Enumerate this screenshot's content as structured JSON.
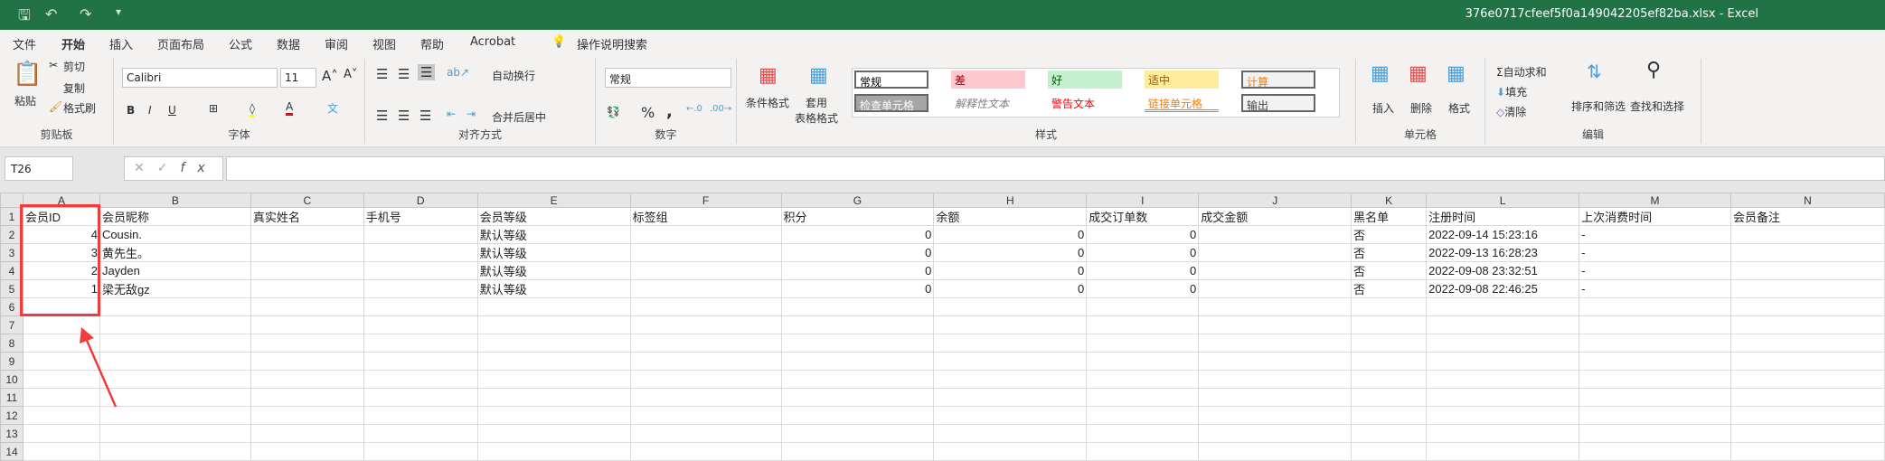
{
  "title_bar": {
    "filename": "376e0717cfeef5f0a149042205ef82ba.xlsx  -  Excel",
    "save_icon": "save-icon",
    "undo_icon": "undo-icon",
    "redo_icon": "redo-icon"
  },
  "tabs": [
    {
      "label": "文件"
    },
    {
      "label": "开始",
      "active": true
    },
    {
      "label": "插入"
    },
    {
      "label": "页面布局"
    },
    {
      "label": "公式"
    },
    {
      "label": "数据"
    },
    {
      "label": "审阅"
    },
    {
      "label": "视图"
    },
    {
      "label": "帮助"
    },
    {
      "label": "Acrobat"
    }
  ],
  "tell_me": "操作说明搜索",
  "ribbon": {
    "clipboard": {
      "label": "剪贴板",
      "paste": "粘贴",
      "cut": "剪切",
      "copy": "复制",
      "format_painter": "格式刷"
    },
    "font": {
      "label": "字体",
      "font_name": "Calibri",
      "font_size": "11",
      "bold": "B",
      "italic": "I",
      "underline": "U"
    },
    "alignment": {
      "label": "对齐方式",
      "wrap": "自动换行",
      "merge": "合并后居中"
    },
    "number": {
      "label": "数字",
      "format": "常规",
      "percent": "%",
      "comma": ","
    },
    "styles": {
      "label": "样式",
      "conditional": "条件格式",
      "table_format": "套用\n表格格式",
      "items": [
        {
          "label": "常规",
          "bg": "#ffffff",
          "color": "#000000"
        },
        {
          "label": "差",
          "bg": "#ffc7ce",
          "color": "#9c0006"
        },
        {
          "label": "好",
          "bg": "#c6efce",
          "color": "#006100"
        },
        {
          "label": "适中",
          "bg": "#ffeb9c",
          "color": "#9c5700"
        },
        {
          "label": "计算",
          "bg": "#f2f2f2",
          "color": "#fa7d00"
        },
        {
          "label": "检查单元格",
          "bg": "#a5a5a5",
          "color": "#ffffff"
        },
        {
          "label": "解释性文本",
          "bg": "#ffffff",
          "color": "#7f7f7f"
        },
        {
          "label": "警告文本",
          "bg": "#ffffff",
          "color": "#ff0000"
        },
        {
          "label": "链接单元格",
          "bg": "#ffffff",
          "color": "#fa7d00"
        },
        {
          "label": "输出",
          "bg": "#f2f2f2",
          "color": "#3f3f3f"
        }
      ]
    },
    "cells": {
      "label": "单元格",
      "insert": "插入",
      "delete": "删除",
      "format": "格式"
    },
    "editing": {
      "label": "编辑",
      "autosum": "自动求和",
      "fill": "填充",
      "clear": "清除",
      "sort_filter": "排序和筛选",
      "find_select": "查找和选择"
    }
  },
  "formula_bar": {
    "name_box": "T26",
    "cancel": "✕",
    "enter": "✓",
    "fx": "fx",
    "value": ""
  },
  "sheet": {
    "columns": [
      "A",
      "B",
      "C",
      "D",
      "E",
      "F",
      "G",
      "H",
      "I",
      "J",
      "K",
      "L",
      "M",
      "N"
    ],
    "rows": [
      [
        "会员ID",
        "会员昵称",
        "真实姓名",
        "手机号",
        "会员等级",
        "标签组",
        "积分",
        "余额",
        "成交订单数",
        "成交金额",
        "黑名单",
        "注册时间",
        "上次消费时间",
        "会员备注"
      ],
      [
        "4",
        "Cousin.",
        "",
        "",
        "默认等级",
        "",
        "0",
        "0",
        "0",
        "",
        "否",
        "2022-09-14 15:23:16",
        "-",
        ""
      ],
      [
        "3",
        "黄先生。",
        "",
        "",
        "默认等级",
        "",
        "0",
        "0",
        "0",
        "",
        "否",
        "2022-09-13 16:28:23",
        "-",
        ""
      ],
      [
        "2",
        "Jayden",
        "",
        "",
        "默认等级",
        "",
        "0",
        "0",
        "0",
        "",
        "否",
        "2022-09-08 23:32:51",
        "-",
        ""
      ],
      [
        "1",
        "梁无敌gz",
        "",
        "",
        "默认等级",
        "",
        "0",
        "0",
        "0",
        "",
        "否",
        "2022-09-08 22:46:25",
        "-",
        ""
      ]
    ],
    "row_count": 14,
    "annotation_color": "#f03c3c"
  }
}
